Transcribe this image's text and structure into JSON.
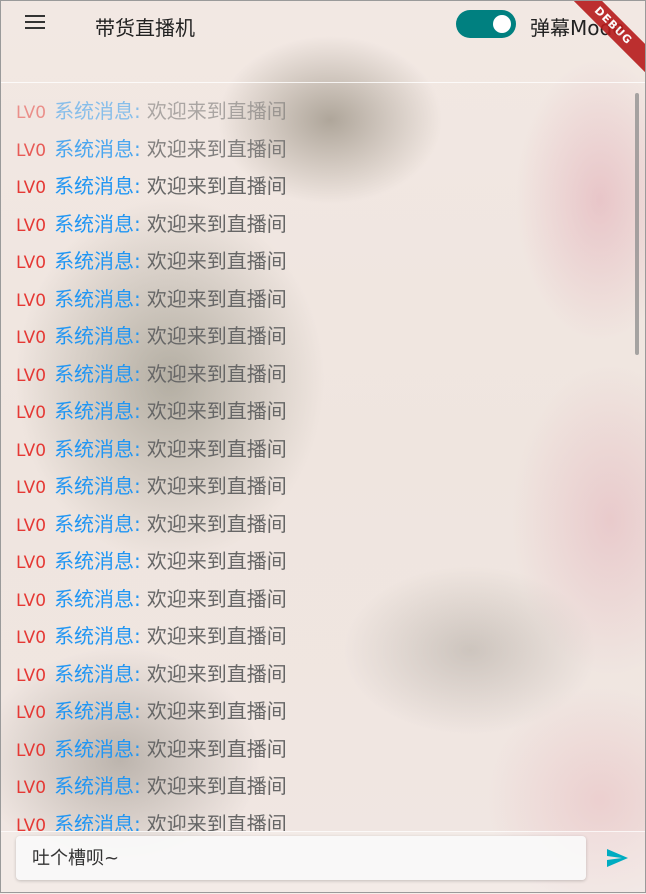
{
  "appbar": {
    "title": "带货直播机",
    "toggle_on": true,
    "mode_label": "弹幕Mode",
    "debug_banner": "DEBUG"
  },
  "chat": {
    "messages": [
      {
        "level": "LV0",
        "sender": "系统消息:",
        "text": "欢迎来到直播间"
      },
      {
        "level": "LV0",
        "sender": "系统消息:",
        "text": "欢迎来到直播间"
      },
      {
        "level": "LV0",
        "sender": "系统消息:",
        "text": "欢迎来到直播间"
      },
      {
        "level": "LV0",
        "sender": "系统消息:",
        "text": "欢迎来到直播间"
      },
      {
        "level": "LV0",
        "sender": "系统消息:",
        "text": "欢迎来到直播间"
      },
      {
        "level": "LV0",
        "sender": "系统消息:",
        "text": "欢迎来到直播间"
      },
      {
        "level": "LV0",
        "sender": "系统消息:",
        "text": "欢迎来到直播间"
      },
      {
        "level": "LV0",
        "sender": "系统消息:",
        "text": "欢迎来到直播间"
      },
      {
        "level": "LV0",
        "sender": "系统消息:",
        "text": "欢迎来到直播间"
      },
      {
        "level": "LV0",
        "sender": "系统消息:",
        "text": "欢迎来到直播间"
      },
      {
        "level": "LV0",
        "sender": "系统消息:",
        "text": "欢迎来到直播间"
      },
      {
        "level": "LV0",
        "sender": "系统消息:",
        "text": "欢迎来到直播间"
      },
      {
        "level": "LV0",
        "sender": "系统消息:",
        "text": "欢迎来到直播间"
      },
      {
        "level": "LV0",
        "sender": "系统消息:",
        "text": "欢迎来到直播间"
      },
      {
        "level": "LV0",
        "sender": "系统消息:",
        "text": "欢迎来到直播间"
      },
      {
        "level": "LV0",
        "sender": "系统消息:",
        "text": "欢迎来到直播间"
      },
      {
        "level": "LV0",
        "sender": "系统消息:",
        "text": "欢迎来到直播间"
      },
      {
        "level": "LV0",
        "sender": "系统消息:",
        "text": "欢迎来到直播间"
      },
      {
        "level": "LV0",
        "sender": "系统消息:",
        "text": "欢迎来到直播间"
      },
      {
        "level": "LV0",
        "sender": "系统消息:",
        "text": "欢迎来到直播间"
      }
    ]
  },
  "composer": {
    "placeholder": "吐个槽呗~",
    "value": ""
  },
  "icons": {
    "menu": "menu-icon",
    "send": "send-icon"
  },
  "colors": {
    "level": "#e53935",
    "sender": "#2196f3",
    "message": "#666666",
    "toggle_track": "#008080",
    "send_icon": "#00acc1",
    "debug_banner": "#b71c1c"
  }
}
